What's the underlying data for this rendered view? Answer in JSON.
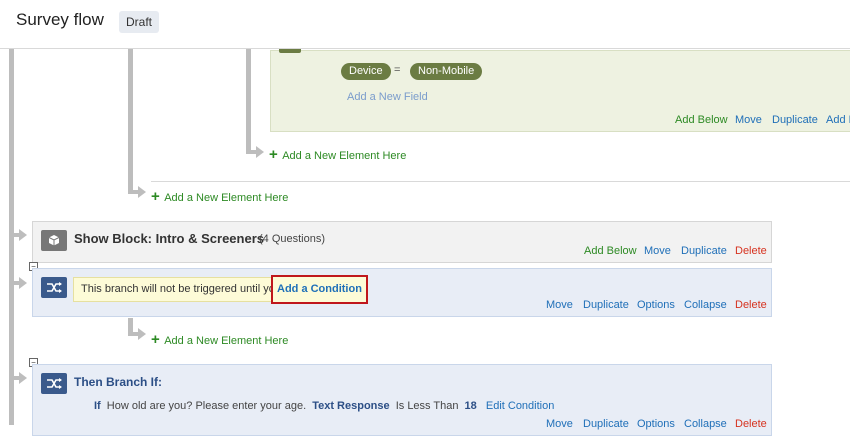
{
  "header": {
    "title": "Survey flow",
    "badge": "Draft"
  },
  "embedded": {
    "field_name": "Device",
    "operator": "=",
    "field_value": "Non-Mobile",
    "add_field": "Add a New Field",
    "actions": [
      "Add Below",
      "Move",
      "Duplicate",
      "Add F"
    ]
  },
  "add_element": "Add a New Element Here",
  "block": {
    "title": "Show Block: Intro & Screeners",
    "count": "(4 Questions)",
    "actions": [
      "Add Below",
      "Move",
      "Duplicate",
      "Delete"
    ]
  },
  "branch1": {
    "warning": "This branch will not be triggered until you",
    "add_condition": "Add a Condition",
    "actions": [
      "Move",
      "Duplicate",
      "Options",
      "Collapse",
      "Delete"
    ]
  },
  "branch2": {
    "title": "Then Branch If:",
    "cond_if": "If",
    "cond_question": "How old are you? Please enter your age.",
    "cond_type": "Text Response",
    "cond_op": "Is Less Than",
    "cond_value": "18",
    "edit": "Edit Condition",
    "actions": [
      "Move",
      "Duplicate",
      "Options",
      "Collapse",
      "Delete"
    ]
  }
}
